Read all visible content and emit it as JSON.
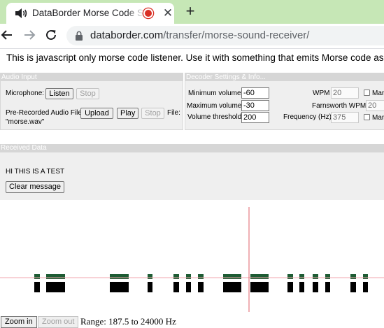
{
  "browser": {
    "tab_title": "DataBorder Morse Code Sou",
    "tab_close_label": "✕",
    "new_tab_label": "+",
    "url_host": "databorder.com",
    "url_path": "/transfer/morse-sound-receiver/",
    "tab_bg_color": "#c6e7b6",
    "recording_indicator_color": "#d93025"
  },
  "page": {
    "intro": "This is javascript only morse code listener. Use it with something that emits Morse code as"
  },
  "audio_input": {
    "header": "Audio Input",
    "microphone_label": "Microphone:",
    "listen_label": "Listen",
    "stop_label": "Stop",
    "prerecorded_label": "Pre-Recorded Audio File",
    "upload_label": "Upload",
    "play_label": "Play",
    "stop2_label": "Stop",
    "file_label": "File:",
    "file_name": "\"morse.wav\""
  },
  "decoder": {
    "header": "Decoder Settings & Info...",
    "min_volume_label": "Minimum volume",
    "min_volume_value": "-60",
    "max_volume_label": "Maximum volume",
    "max_volume_value": "-30",
    "threshold_label": "Volume threshold",
    "threshold_value": "200",
    "wpm_label": "WPM",
    "wpm_value": "20",
    "farnsworth_label": "Farnsworth WPM",
    "farnsworth_value": "20",
    "frequency_label": "Frequency (Hz)",
    "frequency_value": "375",
    "manual_label_1": "Man",
    "manual_label_2": "Man"
  },
  "received": {
    "header": "Received Data",
    "message": "HI THIS IS A TEST",
    "clear_label": "Clear message"
  },
  "spectrogram": {
    "marker_color": "#e0606a",
    "signal_top_color": "#1e5c34",
    "signal_bottom_color": "#000000"
  },
  "zoom": {
    "zoom_in_label": "Zoom in",
    "zoom_out_label": "Zoom out",
    "range_text": "Range: 187.5 to 24000 Hz"
  }
}
